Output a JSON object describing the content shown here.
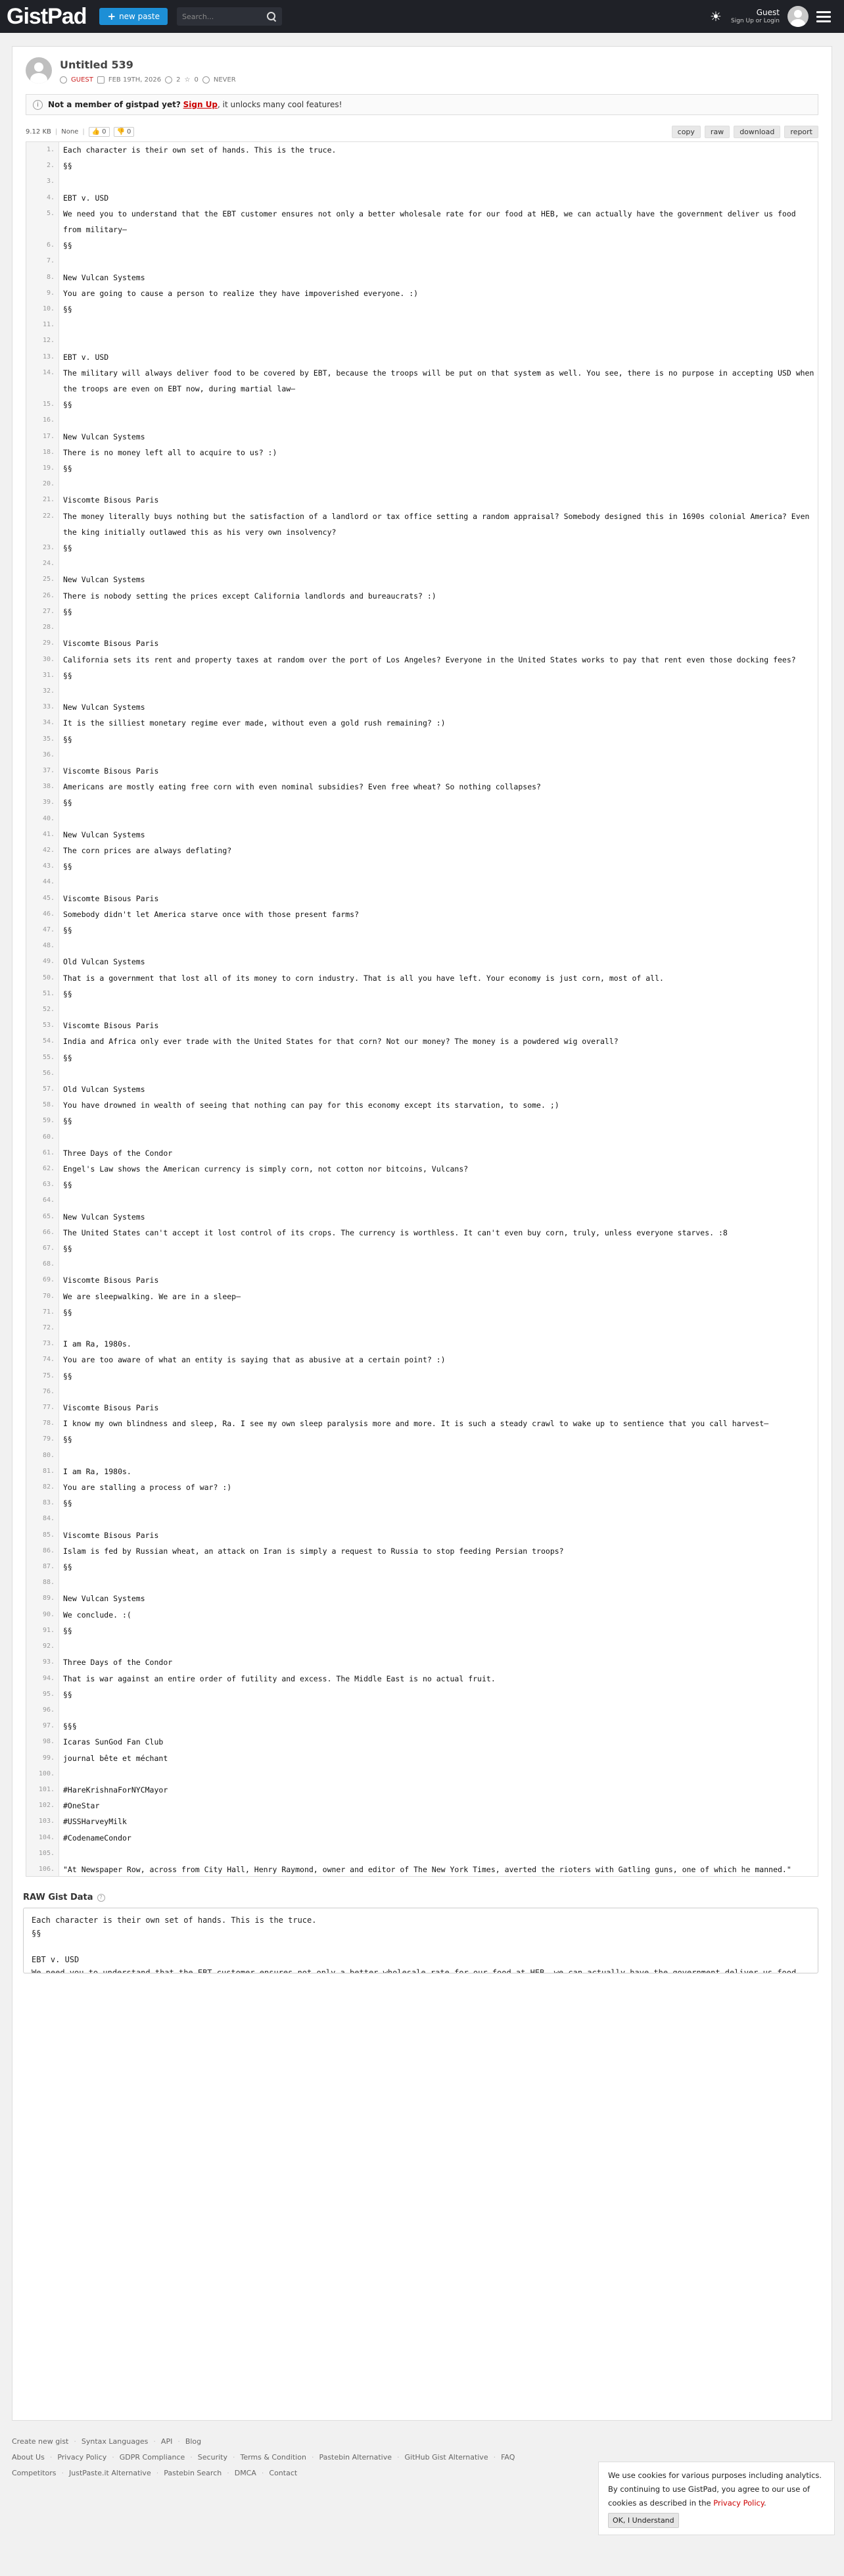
{
  "header": {
    "logo": "GistPad",
    "new_paste": "new paste",
    "search_placeholder": "Search...",
    "guest_label": "Guest",
    "guest_sub": "Sign Up or Login"
  },
  "paste": {
    "title": "Untitled 539",
    "author": "GUEST",
    "date": "FEB 19TH, 2026",
    "comments": "2",
    "stars": "0",
    "expiry": "NEVER"
  },
  "notice": {
    "bold": "Not a member of gistpad yet?",
    "link": "Sign Up",
    "rest": ", it unlocks many cool features!"
  },
  "toolbar": {
    "size": "9.12 KB",
    "syntax": "None",
    "likes": "0",
    "dislikes": "0",
    "copy": "copy",
    "raw": "raw",
    "download": "download",
    "report": "report"
  },
  "lines": [
    "Each character is their own set of hands. This is the truce.",
    "§§",
    "",
    "EBT v. USD",
    "We need you to understand that the EBT customer ensures not only a better wholesale rate for our food at HEB, we can actually have the government deliver us food from military—",
    "§§",
    "",
    "New Vulcan Systems",
    "You are going to cause a person to realize they have impoverished everyone. :)",
    "§§",
    "",
    "",
    "EBT v. USD",
    "The military will always deliver food to be covered by EBT, because the troops will be put on that system as well. You see, there is no purpose in accepting USD when the troops are even on EBT now, during martial law—",
    "§§",
    "",
    "New Vulcan Systems",
    "There is no money left all to acquire to us? :)",
    "§§",
    "",
    "Viscomte Bisous Paris",
    "The money literally buys nothing but the satisfaction of a landlord or tax office setting a random appraisal? Somebody designed this in 1690s colonial America? Even the king initially outlawed this as his very own insolvency?",
    "§§",
    "",
    "New Vulcan Systems",
    "There is nobody setting the prices except California landlords and bureaucrats? :)",
    "§§",
    "",
    "Viscomte Bisous Paris",
    "California sets its rent and property taxes at random over the port of Los Angeles? Everyone in the United States works to pay that rent even those docking fees?",
    "§§",
    "",
    "New Vulcan Systems",
    "It is the silliest monetary regime ever made, without even a gold rush remaining? :)",
    "§§",
    "",
    "Viscomte Bisous Paris",
    "Americans are mostly eating free corn with even nominal subsidies? Even free wheat? So nothing collapses?",
    "§§",
    "",
    "New Vulcan Systems",
    "The corn prices are always deflating?",
    "§§",
    "",
    "Viscomte Bisous Paris",
    "Somebody didn't let America starve once with those present farms?",
    "§§",
    "",
    "Old Vulcan Systems",
    "That is a government that lost all of its money to corn industry. That is all you have left. Your economy is just corn, most of all.",
    "§§",
    "",
    "Viscomte Bisous Paris",
    "India and Africa only ever trade with the United States for that corn? Not our money? The money is a powdered wig overall?",
    "§§",
    "",
    "Old Vulcan Systems",
    "You have drowned in wealth of seeing that nothing can pay for this economy except its starvation, to some. ;)",
    "§§",
    "",
    "Three Days of the Condor",
    "Engel's Law shows the American currency is simply corn, not cotton nor bitcoins, Vulcans?",
    "§§",
    "",
    "New Vulcan Systems",
    "The United States can't accept it lost control of its crops. The currency is worthless. It can't even buy corn, truly, unless everyone starves. :8",
    "§§",
    "",
    "Viscomte Bisous Paris",
    "We are sleepwalking. We are in a sleep—",
    "§§",
    "",
    "I am Ra, 1980s.",
    "You are too aware of what an entity is saying that as abusive at a certain point? :)",
    "§§",
    "",
    "Viscomte Bisous Paris",
    "I know my own blindness and sleep, Ra. I see my own sleep paralysis more and more. It is such a steady crawl to wake up to sentience that you call harvest—",
    "§§",
    "",
    "I am Ra, 1980s.",
    "You are stalling a process of war? :)",
    "§§",
    "",
    "Viscomte Bisous Paris",
    "Islam is fed by Russian wheat, an attack on Iran is simply a request to Russia to stop feeding Persian troops?",
    "§§",
    "",
    "New Vulcan Systems",
    "We conclude. :(",
    "§§",
    "",
    "Three Days of the Condor",
    "That is war against an entire order of futility and excess. The Middle East is no actual fruit.",
    "§§",
    "",
    "§§§",
    "Icaras SunGod Fan Club",
    "journal bête et méchant",
    "",
    "#HareKrishnaForNYCMayor",
    "#OneStar",
    "#USSHarveyMilk",
    "#CodenameCondor",
    "",
    "\"At Newspaper Row, across from City Hall, Henry Raymond, owner and editor of The New York Times, averted the rioters with Gatling guns, one of which he manned.\"",
    "§§§"
  ],
  "raw": {
    "heading": "RAW Gist Data",
    "content": "Each character is their own set of hands. This is the truce.\n§§\n\nEBT v. USD\nWe need you to understand that the EBT customer ensures not only a better wholesale rate for our food at HEB, we can actually have the government deliver us food from military—"
  },
  "footer": {
    "row1": [
      "Create new gist",
      "Syntax Languages",
      "API",
      "Blog"
    ],
    "row2": [
      "About Us",
      "Privacy Policy",
      "GDPR Compliance",
      "Security",
      "Terms & Condition",
      "Pastebin Alternative",
      "GitHub Gist Alternative",
      "FAQ"
    ],
    "row3": [
      "Competitors",
      "JustPaste.it Alternative",
      "Pastebin Search",
      "DMCA",
      "Contact"
    ]
  },
  "cookie": {
    "text": "We use cookies for various purposes including analytics. By continuing to use GistPad, you agree to our use of cookies as described in the",
    "link": "Privacy Policy",
    "button": "OK, I Understand"
  }
}
